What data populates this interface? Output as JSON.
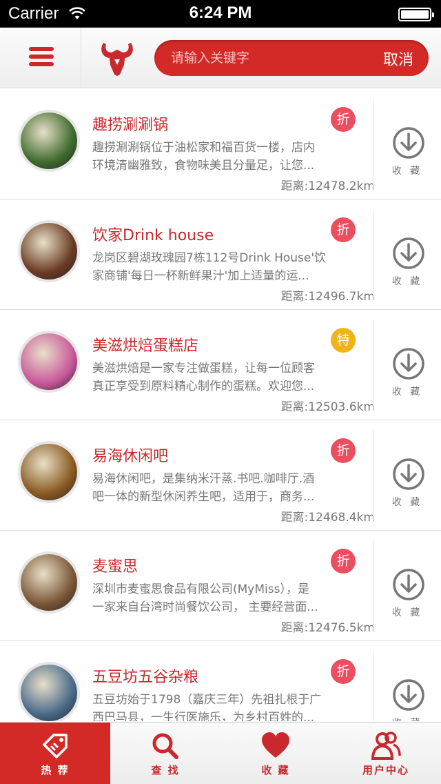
{
  "status_bar": {
    "carrier": "Carrier",
    "time": "6:24 PM",
    "battery_level": 1.0
  },
  "header": {
    "menu_icon": "hamburger-menu-icon",
    "logo_icon": "bull-head-logo",
    "search_placeholder": "请输入关键字",
    "search_value": "",
    "cancel_label": "取消",
    "accent_color": "#d32a27"
  },
  "list": {
    "fav_label": "收 藏",
    "fav_icon": "download-circle-icon",
    "items": [
      {
        "title": "趣捞涮涮锅",
        "tag": "折",
        "tag_color": "#ea4e5f",
        "desc_line1": "趣捞涮涮锅位于油松家和福百货一楼，店内",
        "desc_line2": "环境清幽雅致，食物味美且分量足，让您...",
        "distance": "距离:12478.2km",
        "avatar_color": "#3f6b2e"
      },
      {
        "title": "饮家Drink house",
        "tag": "折",
        "tag_color": "#ea4e5f",
        "desc_line1": "龙岗区碧湖玫瑰园7栋112号Drink House'饮",
        "desc_line2": "家商铺'每日一杯新鲜果汁'加上适量的运...",
        "distance": "距离:12496.7km",
        "avatar_color": "#6a3b23"
      },
      {
        "title": "美滋烘焙蛋糕店",
        "tag": "特",
        "tag_color": "#f1b31c",
        "desc_line1": "美滋烘焙是一家专注做蛋糕，让每一位顾客",
        "desc_line2": "真正享受到原料精心制作的蛋糕。欢迎您...",
        "distance": "距离:12503.6km",
        "avatar_color": "#c9599b"
      },
      {
        "title": "易海休闲吧",
        "tag": "折",
        "tag_color": "#ea4e5f",
        "desc_line1": "易海休闲吧，是集纳米汗蒸.书吧.咖啡厅.酒",
        "desc_line2": "吧一体的新型休闲养生吧，适用于，商务...",
        "distance": "距离:12468.4km",
        "avatar_color": "#8a5a22"
      },
      {
        "title": "麦蜜思",
        "tag": "折",
        "tag_color": "#ea4e5f",
        "desc_line1": "深圳市麦蜜思食品有限公司(MyMiss），是",
        "desc_line2": "一家来自台湾时尚餐饮公司， 主要经营面...",
        "distance": "距离:12476.5km",
        "avatar_color": "#7b5636"
      },
      {
        "title": "五豆坊五谷杂粮",
        "tag": "折",
        "tag_color": "#ea4e5f",
        "desc_line1": "五豆坊始于1798（嘉庆三年）先祖扎根于广",
        "desc_line2": "西巴马县，一生行医施乐，为乡村百姓的...",
        "distance": "",
        "avatar_color": "#4a6a8a"
      }
    ]
  },
  "tab_bar": {
    "tabs": [
      {
        "label": "热 荐",
        "icon": "tag-icon",
        "active": true
      },
      {
        "label": "查 找",
        "icon": "search-icon",
        "active": false
      },
      {
        "label": "收 藏",
        "icon": "heart-icon",
        "active": false
      },
      {
        "label": "用户中心",
        "icon": "users-icon",
        "active": false
      }
    ]
  }
}
